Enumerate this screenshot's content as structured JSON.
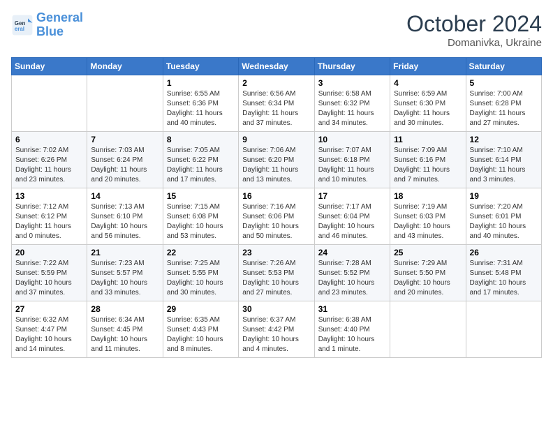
{
  "logo": {
    "line1": "General",
    "line2": "Blue"
  },
  "header": {
    "month": "October 2024",
    "location": "Domanivka, Ukraine"
  },
  "weekdays": [
    "Sunday",
    "Monday",
    "Tuesday",
    "Wednesday",
    "Thursday",
    "Friday",
    "Saturday"
  ],
  "weeks": [
    [
      {
        "day": "",
        "info": ""
      },
      {
        "day": "",
        "info": ""
      },
      {
        "day": "1",
        "info": "Sunrise: 6:55 AM\nSunset: 6:36 PM\nDaylight: 11 hours and 40 minutes."
      },
      {
        "day": "2",
        "info": "Sunrise: 6:56 AM\nSunset: 6:34 PM\nDaylight: 11 hours and 37 minutes."
      },
      {
        "day": "3",
        "info": "Sunrise: 6:58 AM\nSunset: 6:32 PM\nDaylight: 11 hours and 34 minutes."
      },
      {
        "day": "4",
        "info": "Sunrise: 6:59 AM\nSunset: 6:30 PM\nDaylight: 11 hours and 30 minutes."
      },
      {
        "day": "5",
        "info": "Sunrise: 7:00 AM\nSunset: 6:28 PM\nDaylight: 11 hours and 27 minutes."
      }
    ],
    [
      {
        "day": "6",
        "info": "Sunrise: 7:02 AM\nSunset: 6:26 PM\nDaylight: 11 hours and 23 minutes."
      },
      {
        "day": "7",
        "info": "Sunrise: 7:03 AM\nSunset: 6:24 PM\nDaylight: 11 hours and 20 minutes."
      },
      {
        "day": "8",
        "info": "Sunrise: 7:05 AM\nSunset: 6:22 PM\nDaylight: 11 hours and 17 minutes."
      },
      {
        "day": "9",
        "info": "Sunrise: 7:06 AM\nSunset: 6:20 PM\nDaylight: 11 hours and 13 minutes."
      },
      {
        "day": "10",
        "info": "Sunrise: 7:07 AM\nSunset: 6:18 PM\nDaylight: 11 hours and 10 minutes."
      },
      {
        "day": "11",
        "info": "Sunrise: 7:09 AM\nSunset: 6:16 PM\nDaylight: 11 hours and 7 minutes."
      },
      {
        "day": "12",
        "info": "Sunrise: 7:10 AM\nSunset: 6:14 PM\nDaylight: 11 hours and 3 minutes."
      }
    ],
    [
      {
        "day": "13",
        "info": "Sunrise: 7:12 AM\nSunset: 6:12 PM\nDaylight: 11 hours and 0 minutes."
      },
      {
        "day": "14",
        "info": "Sunrise: 7:13 AM\nSunset: 6:10 PM\nDaylight: 10 hours and 56 minutes."
      },
      {
        "day": "15",
        "info": "Sunrise: 7:15 AM\nSunset: 6:08 PM\nDaylight: 10 hours and 53 minutes."
      },
      {
        "day": "16",
        "info": "Sunrise: 7:16 AM\nSunset: 6:06 PM\nDaylight: 10 hours and 50 minutes."
      },
      {
        "day": "17",
        "info": "Sunrise: 7:17 AM\nSunset: 6:04 PM\nDaylight: 10 hours and 46 minutes."
      },
      {
        "day": "18",
        "info": "Sunrise: 7:19 AM\nSunset: 6:03 PM\nDaylight: 10 hours and 43 minutes."
      },
      {
        "day": "19",
        "info": "Sunrise: 7:20 AM\nSunset: 6:01 PM\nDaylight: 10 hours and 40 minutes."
      }
    ],
    [
      {
        "day": "20",
        "info": "Sunrise: 7:22 AM\nSunset: 5:59 PM\nDaylight: 10 hours and 37 minutes."
      },
      {
        "day": "21",
        "info": "Sunrise: 7:23 AM\nSunset: 5:57 PM\nDaylight: 10 hours and 33 minutes."
      },
      {
        "day": "22",
        "info": "Sunrise: 7:25 AM\nSunset: 5:55 PM\nDaylight: 10 hours and 30 minutes."
      },
      {
        "day": "23",
        "info": "Sunrise: 7:26 AM\nSunset: 5:53 PM\nDaylight: 10 hours and 27 minutes."
      },
      {
        "day": "24",
        "info": "Sunrise: 7:28 AM\nSunset: 5:52 PM\nDaylight: 10 hours and 23 minutes."
      },
      {
        "day": "25",
        "info": "Sunrise: 7:29 AM\nSunset: 5:50 PM\nDaylight: 10 hours and 20 minutes."
      },
      {
        "day": "26",
        "info": "Sunrise: 7:31 AM\nSunset: 5:48 PM\nDaylight: 10 hours and 17 minutes."
      }
    ],
    [
      {
        "day": "27",
        "info": "Sunrise: 6:32 AM\nSunset: 4:47 PM\nDaylight: 10 hours and 14 minutes."
      },
      {
        "day": "28",
        "info": "Sunrise: 6:34 AM\nSunset: 4:45 PM\nDaylight: 10 hours and 11 minutes."
      },
      {
        "day": "29",
        "info": "Sunrise: 6:35 AM\nSunset: 4:43 PM\nDaylight: 10 hours and 8 minutes."
      },
      {
        "day": "30",
        "info": "Sunrise: 6:37 AM\nSunset: 4:42 PM\nDaylight: 10 hours and 4 minutes."
      },
      {
        "day": "31",
        "info": "Sunrise: 6:38 AM\nSunset: 4:40 PM\nDaylight: 10 hours and 1 minute."
      },
      {
        "day": "",
        "info": ""
      },
      {
        "day": "",
        "info": ""
      }
    ]
  ]
}
